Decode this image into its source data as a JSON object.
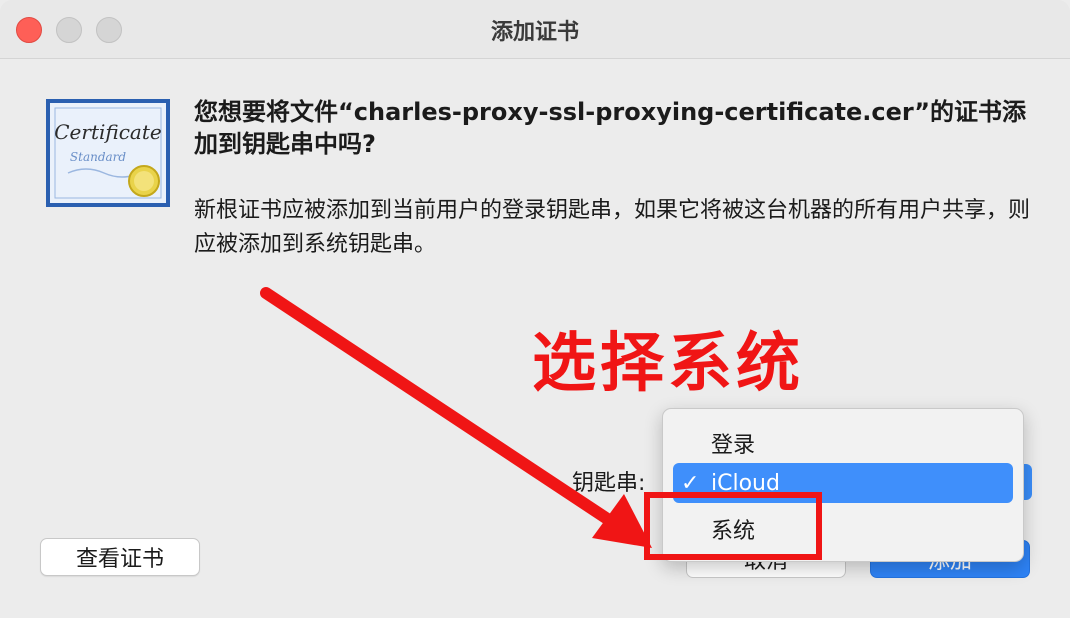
{
  "window": {
    "title": "添加证书"
  },
  "dialog": {
    "question": "您想要将文件“charles-proxy-ssl-proxying-certificate.cer”的证书添加到钥匙串中吗?",
    "description": "新根证书应被添加到当前用户的登录钥匙串，如果它将被这台机器的所有用户共享，则应被添加到系统钥匙串。",
    "keychain_label": "钥匙串:",
    "icon": "certificate-icon"
  },
  "certificate_icon": {
    "text_top": "Certificate",
    "text_bottom": "Standard"
  },
  "keychain_menu": {
    "items": [
      {
        "label": "登录",
        "selected": false
      },
      {
        "label": "iCloud",
        "selected": true
      },
      {
        "label": "系统",
        "selected": false
      }
    ],
    "check_mark": "✓"
  },
  "buttons": {
    "view_certificate": "查看证书",
    "cancel": "取消",
    "add": "添加"
  },
  "annotation": {
    "text": "选择系统",
    "color": "#f01515"
  },
  "colors": {
    "accent": "#3f8ffb",
    "close": "#fe5f57"
  }
}
